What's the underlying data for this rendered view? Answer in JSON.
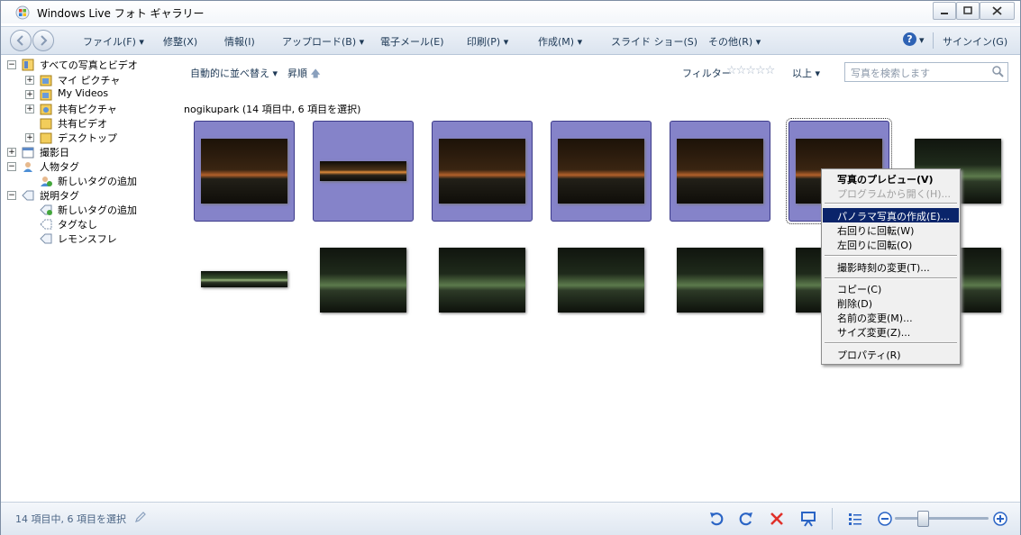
{
  "window": {
    "title": "Windows Live フォト ギャラリー"
  },
  "toolbar": {
    "menus": [
      "ファイル(F)",
      "修整(X)",
      "情報(I)",
      "アップロード(B)",
      "電子メール(E)",
      "印刷(P)",
      "作成(M)",
      "スライド ショー(S)",
      "その他(R)"
    ],
    "sign_in": "サインイン(G)"
  },
  "tree": {
    "all": "すべての写真とビデオ",
    "my_pictures": "マイ ピクチャ",
    "my_videos": "My Videos",
    "shared_pictures": "共有ピクチャ",
    "shared_videos": "共有ビデオ",
    "desktop": "デスクトップ",
    "date_taken": "撮影日",
    "people_tags": "人物タグ",
    "add_people_tag": "新しいタグの追加",
    "descriptive_tags": "説明タグ",
    "add_desc_tag": "新しいタグの追加",
    "no_tag": "タグなし",
    "lemon": "レモンスフレ"
  },
  "sortbar": {
    "auto_sort": "自動的に並べ替え ▾",
    "ascending": "昇順",
    "filter": "フィルター",
    "above": "以上 ▾",
    "search_placeholder": "写真を検索します"
  },
  "group_title": "nogikupark (14 項目中, 6 項目を選択)",
  "context_menu": {
    "preview": "写真のプレビュー(V)",
    "open_with": "プログラムから開く(H)...",
    "panorama": "パノラマ写真の作成(E)...",
    "rotate_right": "右回りに回転(W)",
    "rotate_left": "左回りに回転(O)",
    "change_time": "撮影時刻の変更(T)...",
    "copy": "コピー(C)",
    "delete": "削除(D)",
    "rename": "名前の変更(M)...",
    "resize": "サイズ変更(Z)...",
    "properties": "プロパティ(R)"
  },
  "status": {
    "text": "14 項目中, 6 項目を選択",
    "zoom_level": 0.3
  },
  "colors": {
    "selection": "#8583c9",
    "menu_highlight": "#0a246a"
  }
}
